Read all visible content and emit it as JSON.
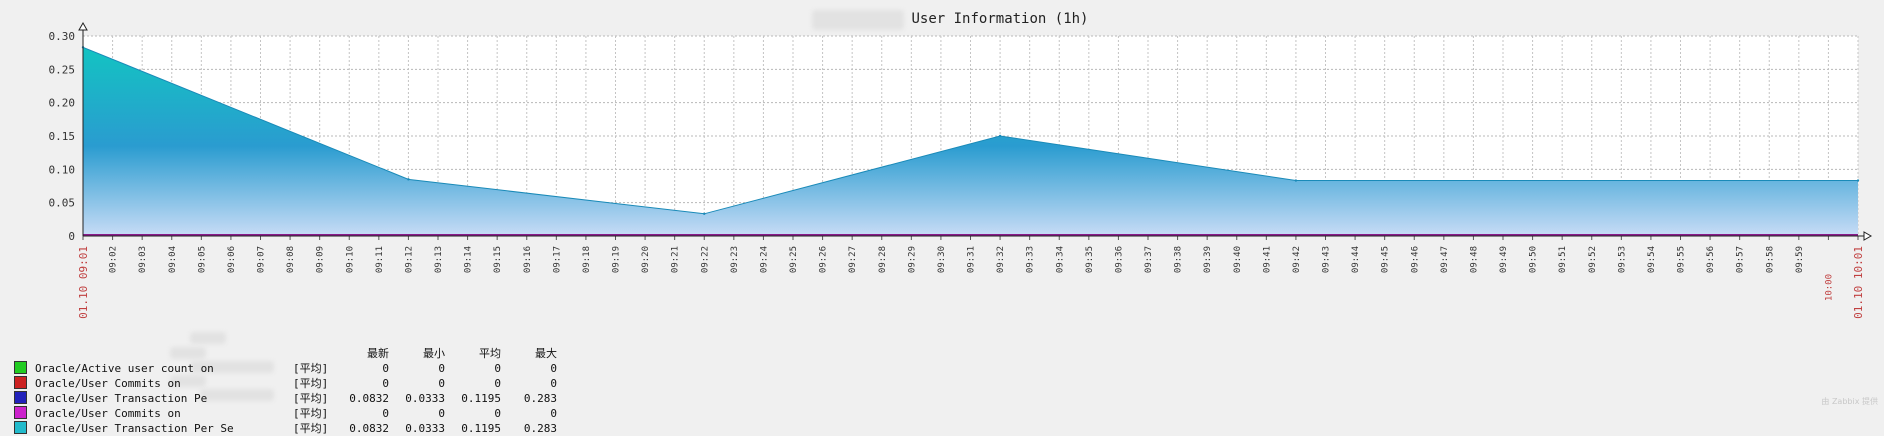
{
  "chart_data": {
    "type": "area",
    "title": "User Information (1h)",
    "x_start_label": "01.10 09:01",
    "x_end_label": "01.10 10:01",
    "x": [
      "09:01",
      "09:02",
      "09:03",
      "09:04",
      "09:05",
      "09:06",
      "09:07",
      "09:08",
      "09:09",
      "09:10",
      "09:11",
      "09:12",
      "09:13",
      "09:14",
      "09:15",
      "09:16",
      "09:17",
      "09:18",
      "09:19",
      "09:20",
      "09:21",
      "09:22",
      "09:23",
      "09:24",
      "09:25",
      "09:26",
      "09:27",
      "09:28",
      "09:29",
      "09:30",
      "09:31",
      "09:32",
      "09:33",
      "09:34",
      "09:35",
      "09:36",
      "09:37",
      "09:38",
      "09:39",
      "09:40",
      "09:41",
      "09:42",
      "09:43",
      "09:44",
      "09:45",
      "09:46",
      "09:47",
      "09:48",
      "09:49",
      "09:50",
      "09:51",
      "09:52",
      "09:53",
      "09:54",
      "09:55",
      "09:56",
      "09:57",
      "09:58",
      "09:59",
      "10:00",
      "10:01"
    ],
    "highlight_ticks": [
      "10:00"
    ],
    "ylim": [
      0,
      0.3
    ],
    "y_ticks": [
      "0",
      "0.05",
      "0.10",
      "0.15",
      "0.20",
      "0.25",
      "0.30"
    ],
    "grid": true,
    "series": [
      {
        "name": "Oracle/User Transaction Per Second",
        "points": [
          {
            "x": "09:01",
            "y": 0.283
          },
          {
            "x": "09:12",
            "y": 0.085
          },
          {
            "x": "09:22",
            "y": 0.0333
          },
          {
            "x": "09:32",
            "y": 0.15
          },
          {
            "x": "09:42",
            "y": 0.0832
          },
          {
            "x": "10:01",
            "y": 0.0832
          }
        ]
      }
    ]
  },
  "legend": {
    "headers": [
      "最新",
      "最小",
      "平均",
      "最大"
    ],
    "rows": [
      {
        "color": "#22cc22",
        "label": "Oracle/Active user count on",
        "agg": "[平均]",
        "last": "0",
        "min": "0",
        "avg": "0",
        "max": "0"
      },
      {
        "color": "#cc2222",
        "label": "Oracle/User Commits on",
        "agg": "[平均]",
        "last": "0",
        "min": "0",
        "avg": "0",
        "max": "0"
      },
      {
        "color": "#2222bb",
        "label": "Oracle/User Transaction Pe",
        "agg": "[平均]",
        "last": "0.0832",
        "min": "0.0333",
        "avg": "0.1195",
        "max": "0.283"
      },
      {
        "color": "#cc22cc",
        "label": "Oracle/User Commits on",
        "agg": "[平均]",
        "last": "0",
        "min": "0",
        "avg": "0",
        "max": "0"
      },
      {
        "color": "#22bbcc",
        "label": "Oracle/User Transaction Per Se",
        "agg": "[平均]",
        "last": "0.0832",
        "min": "0.0333",
        "avg": "0.1195",
        "max": "0.283"
      }
    ]
  },
  "colors": {
    "area_top": "#10c8c0",
    "area_mid": "#2a9cd0",
    "area_bottom": "#c8dcf6",
    "baseline": "#8a1a8a",
    "tick_text": "#333333",
    "tick_highlight": "#c04040"
  },
  "watermark": "由 Zabbix 提供"
}
